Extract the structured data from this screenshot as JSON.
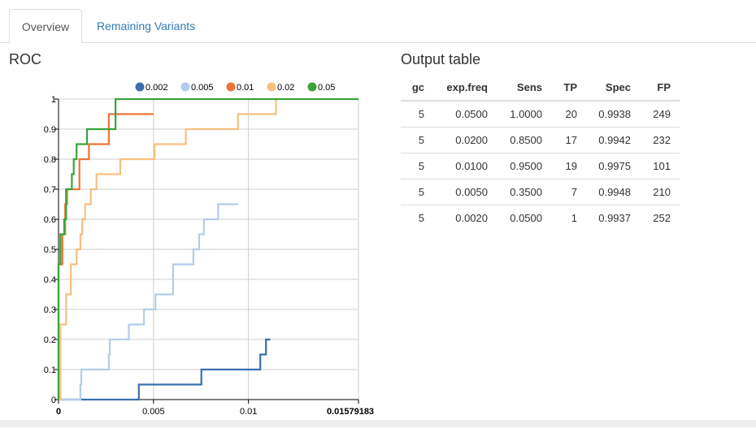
{
  "tabs": [
    {
      "label": "Overview",
      "active": true
    },
    {
      "label": "Remaining Variants",
      "active": false
    }
  ],
  "roc_title": "ROC",
  "table_title": "Output table",
  "table": {
    "columns": [
      "gc",
      "exp.freq",
      "Sens",
      "TP",
      "Spec",
      "FP"
    ],
    "rows": [
      [
        "5",
        "0.0500",
        "1.0000",
        "20",
        "0.9938",
        "249"
      ],
      [
        "5",
        "0.0200",
        "0.8500",
        "17",
        "0.9942",
        "232"
      ],
      [
        "5",
        "0.0100",
        "0.9500",
        "19",
        "0.9975",
        "101"
      ],
      [
        "5",
        "0.0050",
        "0.3500",
        "7",
        "0.9948",
        "210"
      ],
      [
        "5",
        "0.0020",
        "0.0500",
        "1",
        "0.9937",
        "252"
      ]
    ]
  },
  "chart_data": {
    "type": "line",
    "title": "",
    "xlabel": "",
    "ylabel": "",
    "xlim": [
      0,
      0.01579183
    ],
    "ylim": [
      0,
      1
    ],
    "x_ticks": [
      "0",
      "0.005",
      "0.01",
      "0.01579183"
    ],
    "y_ticks": [
      "0",
      "0.1",
      "0.2",
      "0.3",
      "0.4",
      "0.5",
      "0.6",
      "0.7",
      "0.8",
      "0.9",
      "1"
    ],
    "grid": true,
    "legend_position": "top",
    "series": [
      {
        "name": "0.002",
        "color": "#3a6eae",
        "points": [
          [
            0,
            0
          ],
          [
            0.00423,
            0
          ],
          [
            0.00423,
            0.05
          ],
          [
            0.00752,
            0.05
          ],
          [
            0.00752,
            0.1
          ],
          [
            0.01062,
            0.1
          ],
          [
            0.01062,
            0.15
          ],
          [
            0.01092,
            0.15
          ],
          [
            0.01092,
            0.2
          ],
          [
            0.01115,
            0.2
          ]
        ]
      },
      {
        "name": "0.005",
        "color": "#b4cce9",
        "points": [
          [
            0,
            0
          ],
          [
            0.00115,
            0
          ],
          [
            0.00115,
            0.05
          ],
          [
            0.0012,
            0.05
          ],
          [
            0.0012,
            0.1
          ],
          [
            0.00265,
            0.1
          ],
          [
            0.00265,
            0.15
          ],
          [
            0.0027,
            0.15
          ],
          [
            0.0027,
            0.2
          ],
          [
            0.0037,
            0.2
          ],
          [
            0.0037,
            0.25
          ],
          [
            0.0045,
            0.25
          ],
          [
            0.0045,
            0.3
          ],
          [
            0.0051,
            0.3
          ],
          [
            0.0051,
            0.35
          ],
          [
            0.00603,
            0.35
          ],
          [
            0.00603,
            0.45
          ],
          [
            0.0071,
            0.45
          ],
          [
            0.0071,
            0.5
          ],
          [
            0.0074,
            0.5
          ],
          [
            0.0074,
            0.55
          ],
          [
            0.00765,
            0.55
          ],
          [
            0.00765,
            0.6
          ],
          [
            0.0084,
            0.6
          ],
          [
            0.0084,
            0.65
          ],
          [
            0.00945,
            0.65
          ]
        ]
      },
      {
        "name": "0.01",
        "color": "#ee7535",
        "points": [
          [
            0,
            0
          ],
          [
            0,
            0.45
          ],
          [
            0.0002,
            0.45
          ],
          [
            0.0002,
            0.55
          ],
          [
            0.00035,
            0.55
          ],
          [
            0.00035,
            0.65
          ],
          [
            0.00045,
            0.65
          ],
          [
            0.00045,
            0.7
          ],
          [
            0.0011,
            0.7
          ],
          [
            0.0011,
            0.8
          ],
          [
            0.0016,
            0.8
          ],
          [
            0.0016,
            0.85
          ],
          [
            0.00265,
            0.85
          ],
          [
            0.00265,
            0.95
          ],
          [
            0.005,
            0.95
          ]
        ]
      },
      {
        "name": "0.02",
        "color": "#f7bf80",
        "points": [
          [
            0,
            0
          ],
          [
            0.0001,
            0
          ],
          [
            0.0001,
            0.25
          ],
          [
            0.0004,
            0.25
          ],
          [
            0.0004,
            0.35
          ],
          [
            0.00065,
            0.35
          ],
          [
            0.00065,
            0.45
          ],
          [
            0.00095,
            0.45
          ],
          [
            0.00095,
            0.5
          ],
          [
            0.00115,
            0.5
          ],
          [
            0.00115,
            0.55
          ],
          [
            0.00125,
            0.55
          ],
          [
            0.00125,
            0.6
          ],
          [
            0.0014,
            0.6
          ],
          [
            0.0014,
            0.65
          ],
          [
            0.0017,
            0.65
          ],
          [
            0.0017,
            0.7
          ],
          [
            0.002,
            0.7
          ],
          [
            0.002,
            0.75
          ],
          [
            0.00325,
            0.75
          ],
          [
            0.00325,
            0.8
          ],
          [
            0.00505,
            0.8
          ],
          [
            0.00505,
            0.85
          ],
          [
            0.0067,
            0.85
          ],
          [
            0.0067,
            0.9
          ],
          [
            0.00945,
            0.9
          ],
          [
            0.00945,
            0.95
          ],
          [
            0.01145,
            0.95
          ],
          [
            0.01145,
            1
          ]
        ]
      },
      {
        "name": "0.05",
        "color": "#3ba33a",
        "points": [
          [
            0,
            0
          ],
          [
            0,
            0.45
          ],
          [
            0.0001,
            0.45
          ],
          [
            0.0001,
            0.55
          ],
          [
            0.0003,
            0.55
          ],
          [
            0.0003,
            0.6
          ],
          [
            0.0004,
            0.6
          ],
          [
            0.0004,
            0.7
          ],
          [
            0.0007,
            0.7
          ],
          [
            0.0007,
            0.75
          ],
          [
            0.0008,
            0.75
          ],
          [
            0.0008,
            0.8
          ],
          [
            0.00095,
            0.8
          ],
          [
            0.00095,
            0.85
          ],
          [
            0.0011,
            0.85
          ],
          [
            0.0011,
            0.85
          ],
          [
            0.0015,
            0.85
          ],
          [
            0.0015,
            0.9
          ],
          [
            0.003,
            0.9
          ],
          [
            0.003,
            1
          ],
          [
            0.01579183,
            1
          ]
        ]
      }
    ]
  }
}
